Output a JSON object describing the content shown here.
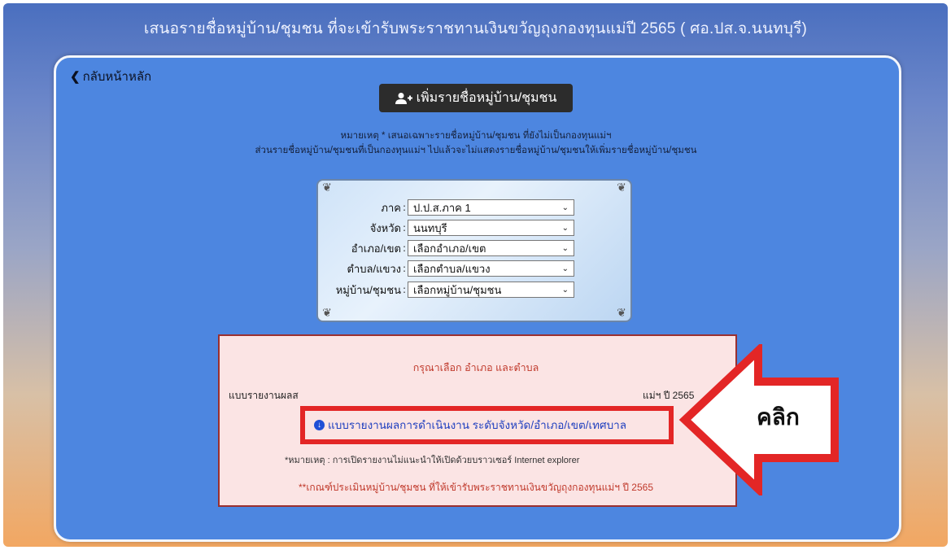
{
  "header": {
    "title": "เสนอรายชื่อหมู่บ้าน/ชุมชน ที่จะเข้ารับพระราชทานเงินขวัญถุงกองทุนแม่ปี 2565 ( ศอ.ปส.จ.นนทบุรี)"
  },
  "nav": {
    "back_label": "กลับหน้าหลัก",
    "back_icon": "chevron-left-icon"
  },
  "add_button": {
    "label": "เพิ่มรายชื่อหมู่บ้าน/ชุมชน",
    "icon": "user-plus-icon"
  },
  "notes": {
    "line1": "หมายเหตุ * เสนอเฉพาะรายชื่อหมู่บ้าน/ชุมชน ที่ยังไม่เป็นกองทุนแม่ฯ",
    "line2": "ส่วนรายชื่อหมู่บ้าน/ชุมชนที่เป็นกองทุนแม่ฯ ไปแล้วจะไม่แสดงรายชื่อหมู่บ้าน/ชุมชนให้เพิ่มรายชื่อหมู่บ้าน/ชุมชน"
  },
  "form": {
    "fields": [
      {
        "label": "ภาค",
        "value": "ป.ป.ส.ภาค 1"
      },
      {
        "label": "จังหวัด",
        "value": "นนทบุรี"
      },
      {
        "label": "อำเภอ/เขต",
        "value": "เลือกอำเภอ/เขต"
      },
      {
        "label": "ตำบล/แขวง",
        "value": "เลือกตำบล/แขวง"
      },
      {
        "label": "หมู่บ้าน/ชุมชน",
        "value": "เลือกหมู่บ้าน/ชุมชน"
      }
    ]
  },
  "info": {
    "prompt": "กรุณาเลือก อำเภอ และตำบล",
    "report_line_left": "แบบรายงานผลส",
    "report_line_right": "แม่ฯ ปี 2565",
    "report_link": "แบบรายงานผลการดำเนินงาน ระดับจังหวัด/อำเภอ/เขต/เทศบาล",
    "browser_note": "*หมายเหตุ : การเปิดรายงานไม่แนะนำให้เปิดด้วยบราวเซอร์ Internet explorer",
    "criteria_link": "**เกณฑ์ประเมินหมู่บ้าน/ชุมชน ที่ให้เข้ารับพระราชทานเงินขวัญถุงกองทุนแม่ฯ ปี 2565"
  },
  "callout": {
    "text": "คลิก",
    "highlight_color": "#e32626"
  }
}
